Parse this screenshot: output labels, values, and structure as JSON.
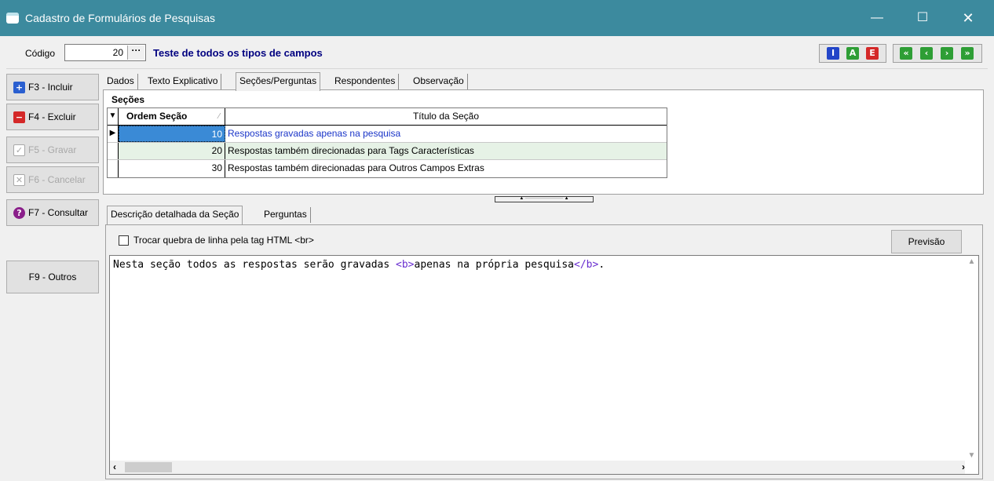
{
  "window": {
    "title": "Cadastro de Formulários de Pesquisas",
    "minimize_glyph": "—",
    "maximize_glyph": "☐",
    "close_glyph": "✕"
  },
  "header": {
    "code_label": "Código",
    "code_value": "20",
    "code_button": "···",
    "description": "Teste de todos os tipos de campos",
    "iae_buttons": [
      "I",
      "A",
      "E"
    ],
    "nav_buttons": [
      "«",
      "‹",
      "›",
      "»"
    ],
    "colors": {
      "blue": "#2245c8",
      "green": "#2e9e35",
      "red": "#d42828"
    }
  },
  "sidebar": {
    "buttons": [
      {
        "label": "F3 - Incluir",
        "icon": "plus-icon",
        "glyph": "+",
        "color": "#2a5fd0",
        "enabled": true
      },
      {
        "label": "F4 - Excluir",
        "icon": "minus-icon",
        "glyph": "−",
        "color": "#d42828",
        "enabled": true
      },
      {
        "label": "F5 - Gravar",
        "icon": "check-icon",
        "glyph": "✓",
        "enabled": false
      },
      {
        "label": "F6 - Cancelar",
        "icon": "x-icon",
        "glyph": "✕",
        "enabled": false
      },
      {
        "label": "F7 - Consultar",
        "icon": "question-icon",
        "glyph": "?",
        "color": "#8a1f8a",
        "enabled": true
      },
      {
        "label": "F9 - Outros"
      }
    ]
  },
  "tabs": [
    "Dados",
    "Texto Explicativo",
    "Seções/Perguntas",
    "Respondentes",
    "Observação"
  ],
  "active_tab": "Seções/Perguntas",
  "secoes": {
    "group_label": "Seções",
    "columns": [
      "Ordem Seção",
      "Título da Seção"
    ],
    "rows": [
      {
        "ordem": "10",
        "titulo": "Respostas gravadas apenas na pesquisa"
      },
      {
        "ordem": "20",
        "titulo": "Respostas também direcionadas para Tags Características"
      },
      {
        "ordem": "30",
        "titulo": "Respostas também direcionadas para Outros Campos Extras"
      }
    ]
  },
  "subtabs": [
    "Descrição detalhada da Seção",
    "Perguntas"
  ],
  "active_subtab": "Descrição detalhada da Seção",
  "descricao": {
    "checkbox_label": "Trocar quebra de linha pela tag HTML <br>",
    "checkbox_checked": false,
    "preview_button": "Previsão",
    "text_before": "Nesta seção todos as respostas serão gravadas ",
    "tag_open": "<b>",
    "text_bold": "apenas na própria pesquisa",
    "tag_close": "</b>",
    "text_after": "."
  }
}
